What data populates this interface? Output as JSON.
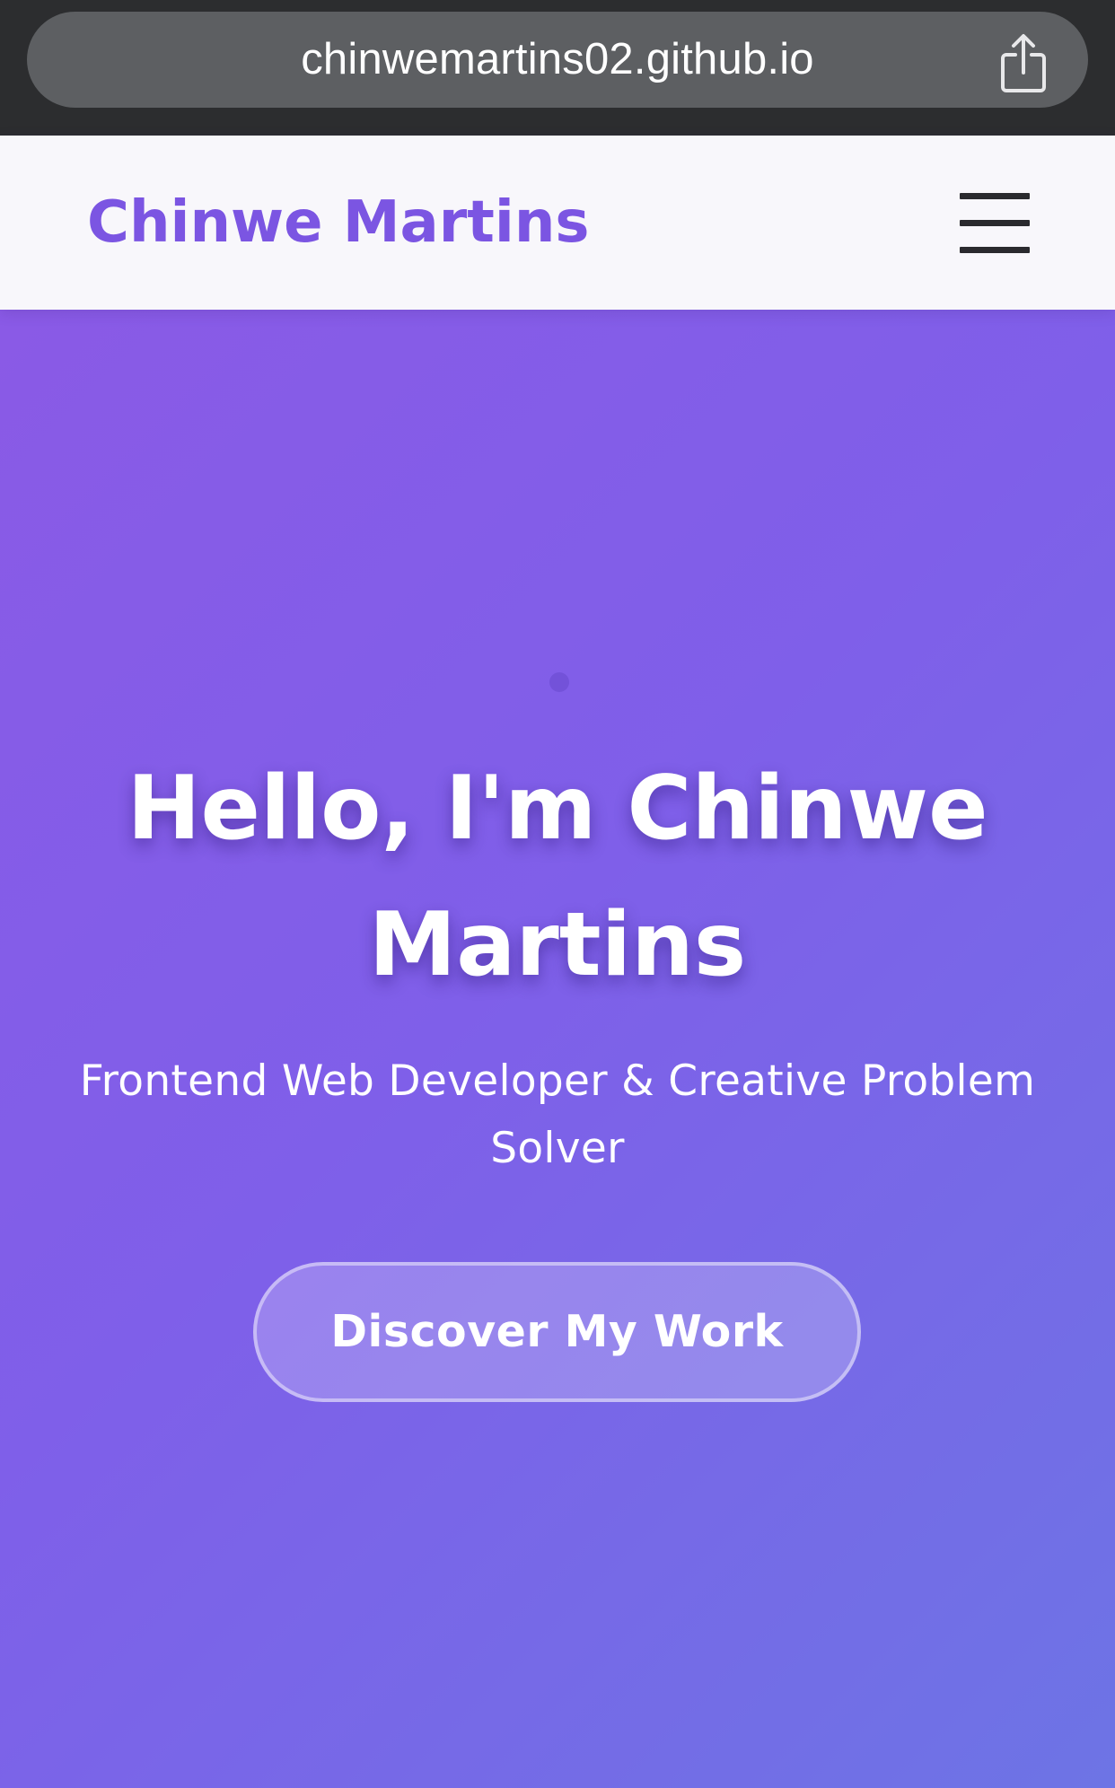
{
  "browser": {
    "url": "chinwemartins02.github.io",
    "share_icon": "share-icon"
  },
  "navbar": {
    "logo": "Chinwe Martins",
    "menu_icon": "hamburger-menu-icon"
  },
  "hero": {
    "title": "Hello, I'm Chinwe Martins",
    "subtitle": "Frontend Web Developer & Creative Problem Solver",
    "cta_label": "Discover My Work"
  },
  "colors": {
    "brand": "#7b55e2",
    "hero_gradient_start": "#8a5ae6",
    "hero_gradient_end": "#6d74e5",
    "navbar_bg": "#f8f7fb",
    "browser_bar_bg": "#2c2d2f",
    "url_pill_bg": "#5d5f62"
  }
}
